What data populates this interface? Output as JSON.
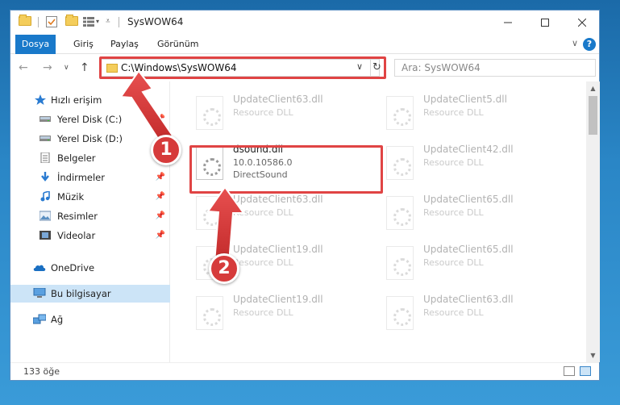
{
  "window": {
    "title": "SysWOW64"
  },
  "ribbon": {
    "tabs": [
      "Dosya",
      "Giriş",
      "Paylaş",
      "Görünüm"
    ],
    "help": "?"
  },
  "nav": {
    "address": "C:\\Windows\\SysWOW64",
    "search_placeholder": "Ara: SysWOW64"
  },
  "navpane": {
    "items": [
      {
        "label": "Hızlı erişim",
        "icon": "star-icon"
      },
      {
        "label": "Yerel Disk (C:)",
        "icon": "drive-icon"
      },
      {
        "label": "Yerel Disk (D:)",
        "icon": "drive-icon"
      },
      {
        "label": "Belgeler",
        "icon": "documents-icon"
      },
      {
        "label": "İndirmeler",
        "icon": "download-icon"
      },
      {
        "label": "Müzik",
        "icon": "music-icon"
      },
      {
        "label": "Resimler",
        "icon": "pictures-icon"
      },
      {
        "label": "Videolar",
        "icon": "video-icon"
      },
      {
        "label": "OneDrive",
        "icon": "cloud-icon"
      },
      {
        "label": "Bu bilgisayar",
        "icon": "computer-icon"
      },
      {
        "label": "Ağ",
        "icon": "network-icon"
      }
    ]
  },
  "files": [
    {
      "name": "UpdateClient63.dll",
      "desc": "Resource DLL"
    },
    {
      "name": "UpdateClient5.dll",
      "desc": "Resource DLL"
    },
    {
      "name": "dsound.dll",
      "version": "10.0.10586.0",
      "desc": "DirectSound"
    },
    {
      "name": "UpdateClient42.dll",
      "desc": "Resource DLL"
    },
    {
      "name": "UpdateClient63.dll",
      "desc": "Resource DLL"
    },
    {
      "name": "UpdateClient65.dll",
      "desc": "Resource DLL"
    },
    {
      "name": "UpdateClient19.dll",
      "desc": "Resource DLL"
    },
    {
      "name": "UpdateClient65.dll",
      "desc": "Resource DLL"
    },
    {
      "name": "UpdateClient19.dll",
      "desc": "Resource DLL"
    },
    {
      "name": "UpdateClient63.dll",
      "desc": "Resource DLL"
    }
  ],
  "status": {
    "count": "133 öğe"
  },
  "annotations": {
    "step1": "1",
    "step2": "2",
    "accent": "#d63b3b"
  }
}
